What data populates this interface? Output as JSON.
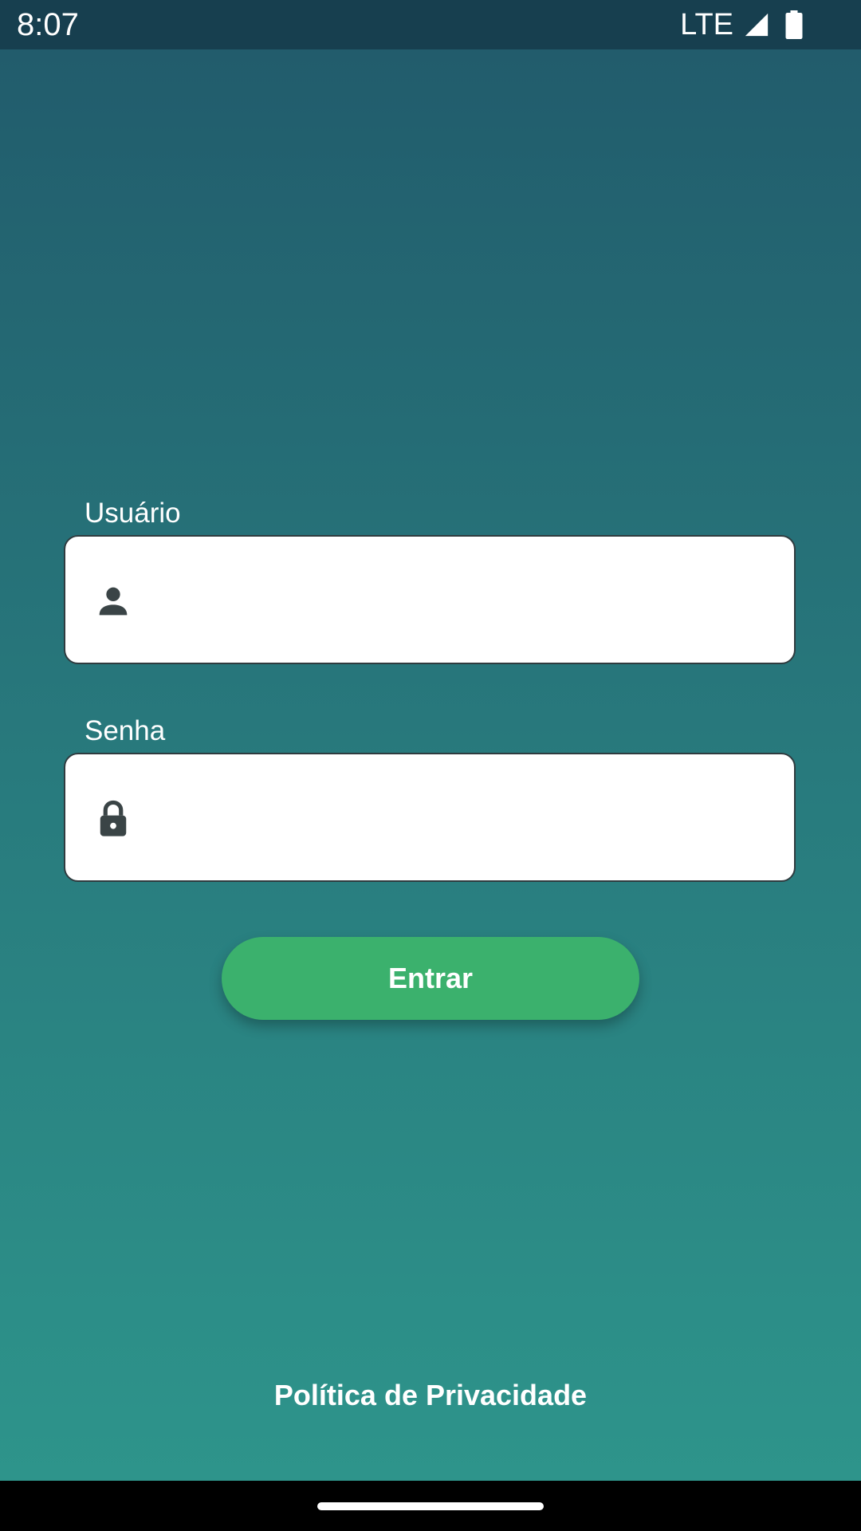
{
  "status_bar": {
    "time": "8:07",
    "network": "LTE",
    "icons": [
      "signal-icon",
      "battery-icon"
    ]
  },
  "login_form": {
    "username": {
      "label": "Usuário",
      "value": "",
      "icon": "person-icon"
    },
    "password": {
      "label": "Senha",
      "value": "",
      "icon": "lock-icon"
    },
    "submit_label": "Entrar"
  },
  "footer": {
    "privacy_link": "Política de Privacidade"
  },
  "colors": {
    "background_top": "#215a6b",
    "background_bottom": "#2e968c",
    "status_bar": "#173f4f",
    "button": "#3bb16d",
    "icon": "#3a4446"
  }
}
